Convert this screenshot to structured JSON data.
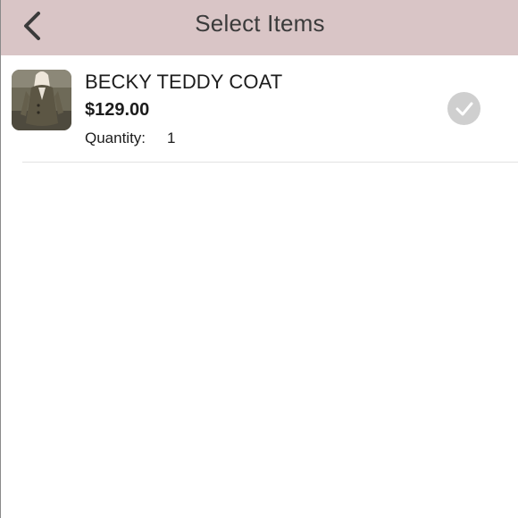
{
  "header": {
    "title": "Select Items",
    "back_icon": "chevron-left-icon",
    "background_color": "#d9c5c6"
  },
  "items": [
    {
      "name": "BECKY TEDDY COAT",
      "price": "$129.00",
      "quantity_label": "Quantity:",
      "quantity_value": "1",
      "image_icon": "coat-photo",
      "selected": false,
      "check_icon": "checkmark-circle-icon",
      "check_color": "#cfcfcf"
    }
  ]
}
